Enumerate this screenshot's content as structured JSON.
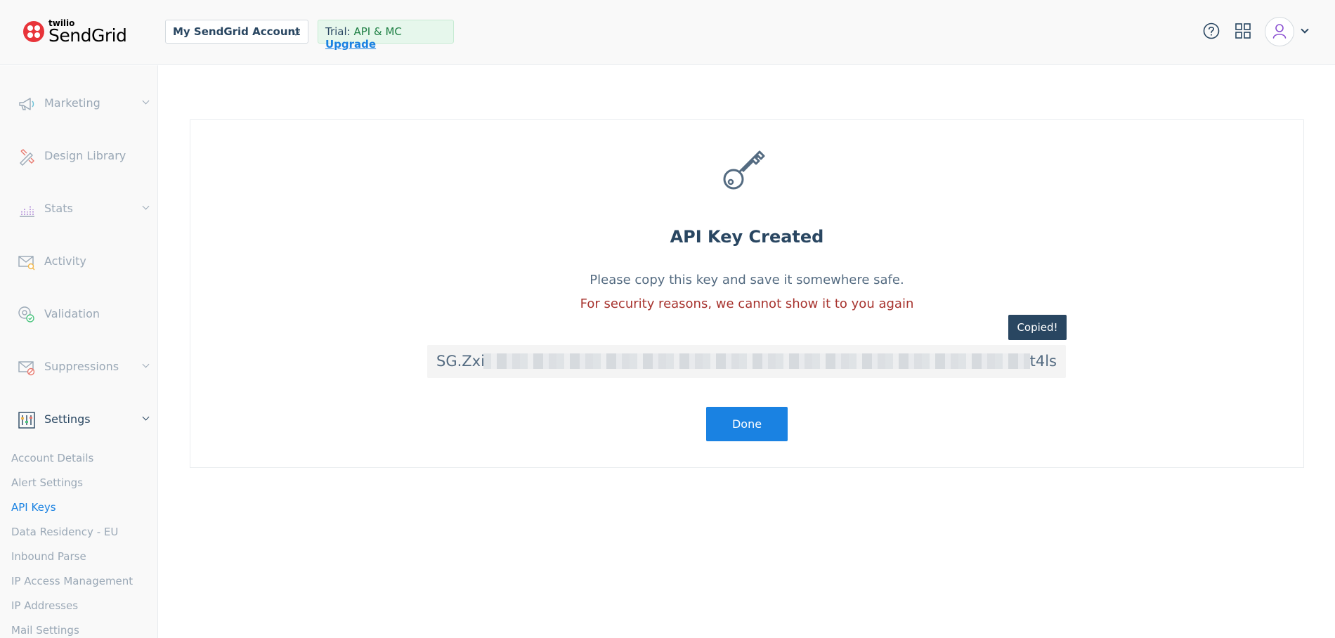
{
  "brand": {
    "small": "twilio",
    "name": "SendGrid"
  },
  "header": {
    "account_label": "My SendGrid Account",
    "trial_prefix": "Trial:",
    "trial_plan": "API & MC",
    "upgrade_label": "Upgrade"
  },
  "sidebar": {
    "items": [
      {
        "label": "Marketing",
        "icon": "megaphone-icon",
        "has_chevron": true
      },
      {
        "label": "Design Library",
        "icon": "design-tools-icon",
        "has_chevron": false
      },
      {
        "label": "Stats",
        "icon": "bar-chart-icon",
        "has_chevron": true
      },
      {
        "label": "Activity",
        "icon": "envelope-search-icon",
        "has_chevron": false
      },
      {
        "label": "Validation",
        "icon": "at-check-icon",
        "has_chevron": false
      },
      {
        "label": "Suppressions",
        "icon": "envelope-block-icon",
        "has_chevron": true
      },
      {
        "label": "Settings",
        "icon": "sliders-icon",
        "has_chevron": true,
        "expanded": true
      }
    ],
    "settings_subitems": [
      "Account Details",
      "Alert Settings",
      "API Keys",
      "Data Residency - EU",
      "Inbound Parse",
      "IP Access Management",
      "IP Addresses",
      "Mail Settings"
    ],
    "current_subitem": "API Keys"
  },
  "main": {
    "title": "API Key Created",
    "description": "Please copy this key and save it somewhere safe.",
    "warning": "For security reasons, we cannot show it to you again",
    "tooltip": "Copied!",
    "key_prefix": "SG.Zxi",
    "key_suffix": "t4ls",
    "done_label": "Done"
  },
  "colors": {
    "accent": "#1a82e2",
    "navy": "#294661",
    "warning": "#a7332e",
    "brand_red": "#e8343a",
    "trial_green": "#1d7f43"
  }
}
